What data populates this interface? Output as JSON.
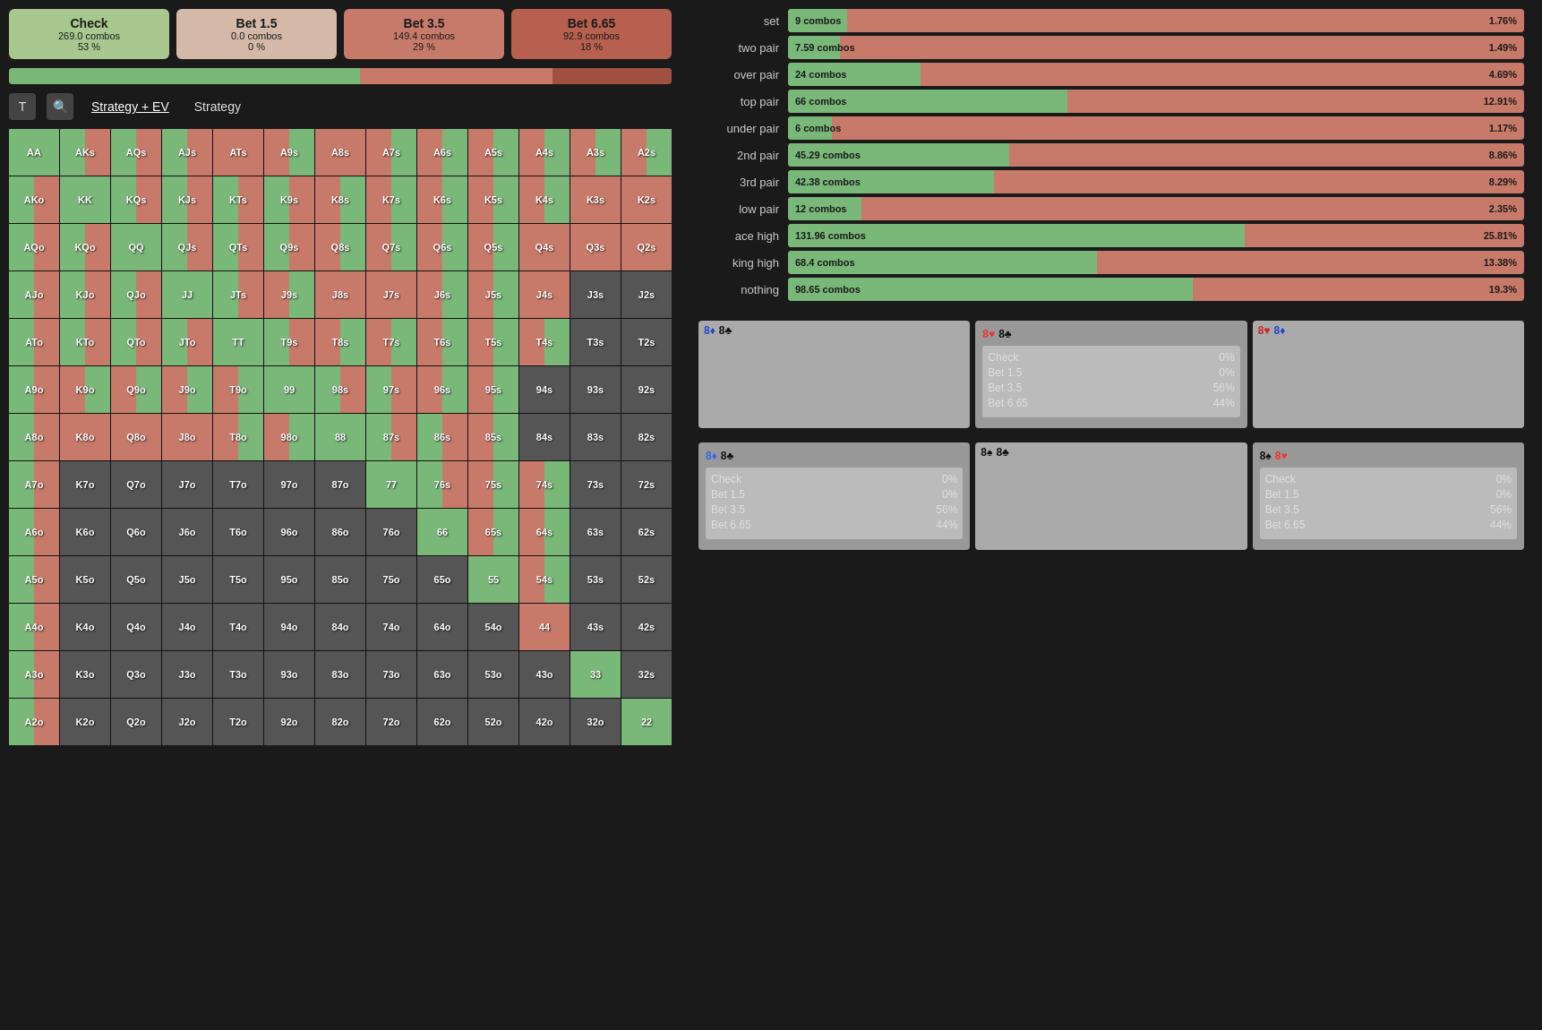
{
  "action_buttons": [
    {
      "id": "check",
      "label": "Check",
      "combos": "269.0 combos",
      "pct": "53 %",
      "active": true
    },
    {
      "id": "bet15",
      "label": "Bet 1.5",
      "combos": "0.0 combos",
      "pct": "0 %",
      "active": false
    },
    {
      "id": "bet35",
      "label": "Bet 3.5",
      "combos": "149.4 combos",
      "pct": "29 %",
      "active": false
    },
    {
      "id": "bet665",
      "label": "Bet 6.65",
      "combos": "92.9 combos",
      "pct": "18 %",
      "active": false
    }
  ],
  "progress": [
    {
      "pct": 53,
      "color": "#7ab87a"
    },
    {
      "pct": 0,
      "color": "#c8a090"
    },
    {
      "pct": 29,
      "color": "#c87a6a"
    },
    {
      "pct": 18,
      "color": "#c86a50"
    }
  ],
  "toolbar": {
    "strategy_ev_label": "Strategy + EV",
    "strategy_label": "Strategy"
  },
  "stats": [
    {
      "label": "set",
      "combos": "9 combos",
      "pct": "1.76%",
      "fill": 8
    },
    {
      "label": "two pair",
      "combos": "7.59 combos",
      "pct": "1.49%",
      "fill": 7
    },
    {
      "label": "over pair",
      "combos": "24 combos",
      "pct": "4.69%",
      "fill": 18
    },
    {
      "label": "top pair",
      "combos": "66 combos",
      "pct": "12.91%",
      "fill": 38
    },
    {
      "label": "under pair",
      "combos": "6 combos",
      "pct": "1.17%",
      "fill": 6
    },
    {
      "label": "2nd pair",
      "combos": "45.29 combos",
      "pct": "8.86%",
      "fill": 30
    },
    {
      "label": "3rd pair",
      "combos": "42.38 combos",
      "pct": "8.29%",
      "fill": 28
    },
    {
      "label": "low pair",
      "combos": "12 combos",
      "pct": "2.35%",
      "fill": 10
    },
    {
      "label": "ace high",
      "combos": "131.96 combos",
      "pct": "25.81%",
      "fill": 62
    },
    {
      "label": "king high",
      "combos": "68.4 combos",
      "pct": "13.38%",
      "fill": 42
    },
    {
      "label": "nothing",
      "combos": "98.65 combos",
      "pct": "19.3%",
      "fill": 55
    }
  ],
  "combo_panels_row1": [
    {
      "id": "panel-8d8c",
      "header": [
        {
          "rank": "8",
          "suit": "♦",
          "suit_color": "blue"
        },
        {
          "rank": "8",
          "suit": "♣",
          "suit_color": "black"
        }
      ],
      "empty": true
    },
    {
      "id": "panel-8h8c",
      "header": [
        {
          "rank": "8",
          "suit": "♥",
          "suit_color": "red"
        },
        {
          "rank": "8",
          "suit": "♣",
          "suit_color": "black"
        }
      ],
      "actions": [
        {
          "name": "Check",
          "pct": "0%"
        },
        {
          "name": "Bet 1.5",
          "pct": "0%"
        },
        {
          "name": "Bet 3.5",
          "pct": "56%"
        },
        {
          "name": "Bet 6.65",
          "pct": "44%"
        }
      ]
    },
    {
      "id": "panel-8h8d",
      "header": [
        {
          "rank": "8",
          "suit": "♥",
          "suit_color": "red"
        },
        {
          "rank": "8",
          "suit": "♦",
          "suit_color": "blue"
        }
      ],
      "empty": true
    }
  ],
  "combo_panels_row2": [
    {
      "id": "panel-8d8c-2",
      "header": [
        {
          "rank": "8",
          "suit": "♦",
          "suit_color": "blue"
        },
        {
          "rank": "8",
          "suit": "♣",
          "suit_color": "black"
        }
      ],
      "actions": [
        {
          "name": "Check",
          "pct": "0%"
        },
        {
          "name": "Bet 1.5",
          "pct": "0%"
        },
        {
          "name": "Bet 3.5",
          "pct": "56%"
        },
        {
          "name": "Bet 6.65",
          "pct": "44%"
        }
      ]
    },
    {
      "id": "panel-8s8c",
      "header": [
        {
          "rank": "8",
          "suit": "♠",
          "suit_color": "black"
        },
        {
          "rank": "8",
          "suit": "♣",
          "suit_color": "black"
        }
      ],
      "empty": true
    },
    {
      "id": "panel-8s8h",
      "header": [
        {
          "rank": "8",
          "suit": "♠",
          "suit_color": "black"
        },
        {
          "rank": "8",
          "suit": "♥",
          "suit_color": "red"
        }
      ],
      "actions": [
        {
          "name": "Check",
          "pct": "0%"
        },
        {
          "name": "Bet 1.5",
          "pct": "0%"
        },
        {
          "name": "Bet 3.5",
          "pct": "56%"
        },
        {
          "name": "Bet 6.65",
          "pct": "44%"
        }
      ]
    }
  ],
  "grid": {
    "rows": [
      [
        "AA",
        "AKs",
        "AQs",
        "AJs",
        "ATs",
        "A9s",
        "A8s",
        "A7s",
        "A6s",
        "A5s",
        "A4s",
        "A3s",
        "A2s"
      ],
      [
        "AKo",
        "KK",
        "KQs",
        "KJs",
        "KTs",
        "K9s",
        "K8s",
        "K7s",
        "K6s",
        "K5s",
        "K4s",
        "K3s",
        "K2s"
      ],
      [
        "AQo",
        "KQo",
        "QQ",
        "QJs",
        "QTs",
        "Q9s",
        "Q8s",
        "Q7s",
        "Q6s",
        "Q5s",
        "Q4s",
        "Q3s",
        "Q2s"
      ],
      [
        "AJo",
        "KJo",
        "QJo",
        "JJ",
        "JTs",
        "J9s",
        "J8s",
        "J7s",
        "J6s",
        "J5s",
        "J4s",
        "J3s",
        "J2s"
      ],
      [
        "ATo",
        "KTo",
        "QTo",
        "JTo",
        "TT",
        "T9s",
        "T8s",
        "T7s",
        "T6s",
        "T5s",
        "T4s",
        "T3s",
        "T2s"
      ],
      [
        "A9o",
        "K9o",
        "Q9o",
        "J9o",
        "T9o",
        "99",
        "98s",
        "97s",
        "96s",
        "95s",
        "94s",
        "93s",
        "92s"
      ],
      [
        "A8o",
        "K8o",
        "Q8o",
        "J8o",
        "T8o",
        "98o",
        "88",
        "87s",
        "86s",
        "85s",
        "84s",
        "83s",
        "82s"
      ],
      [
        "A7o",
        "K7o",
        "Q7o",
        "J7o",
        "T7o",
        "97o",
        "87o",
        "77",
        "76s",
        "75s",
        "74s",
        "73s",
        "72s"
      ],
      [
        "A6o",
        "K6o",
        "Q6o",
        "J6o",
        "T6o",
        "96o",
        "86o",
        "76o",
        "66",
        "65s",
        "64s",
        "63s",
        "62s"
      ],
      [
        "A5o",
        "K5o",
        "Q5o",
        "J5o",
        "T5o",
        "95o",
        "85o",
        "75o",
        "65o",
        "55",
        "54s",
        "53s",
        "52s"
      ],
      [
        "A4o",
        "K4o",
        "Q4o",
        "J4o",
        "T4o",
        "94o",
        "84o",
        "74o",
        "64o",
        "54o",
        "44",
        "43s",
        "42s"
      ],
      [
        "A3o",
        "K3o",
        "Q3o",
        "J3o",
        "T3o",
        "93o",
        "83o",
        "73o",
        "63o",
        "53o",
        "43o",
        "33",
        "32s"
      ],
      [
        "A2o",
        "K2o",
        "Q2o",
        "J2o",
        "T2o",
        "92o",
        "82o",
        "72o",
        "62o",
        "52o",
        "42o",
        "32o",
        "22"
      ]
    ],
    "cell_colors": {
      "AA": "green",
      "AKs": "mixed-gs",
      "AQs": "mixed-gs",
      "AJs": "mixed-gs",
      "ATs": "salmon",
      "A9s": "mixed-sg",
      "A8s": "salmon",
      "A7s": "mixed-sg",
      "A6s": "mixed-sg",
      "A5s": "mixed-sg",
      "A4s": "mixed-sg",
      "A3s": "mixed-sg",
      "A2s": "mixed-sg",
      "AKo": "mixed-gs",
      "KK": "green",
      "KQs": "mixed-gs",
      "KJs": "mixed-gs",
      "KTs": "mixed-gs",
      "K9s": "mixed-gs",
      "K8s": "mixed-sg",
      "K7s": "mixed-sg",
      "K6s": "mixed-sg",
      "K5s": "mixed-sg",
      "K4s": "mixed-sg",
      "K3s": "salmon",
      "K2s": "salmon",
      "AQo": "mixed-gs",
      "KQo": "mixed-gs",
      "QQ": "green",
      "QJs": "mixed-gs",
      "QTs": "mixed-gs",
      "Q9s": "mixed-gs",
      "Q8s": "mixed-sg",
      "Q7s": "mixed-sg",
      "Q6s": "mixed-sg",
      "Q5s": "mixed-sg",
      "Q4s": "salmon",
      "Q3s": "salmon",
      "Q2s": "salmon",
      "AJo": "mixed-gs",
      "KJo": "mixed-gs",
      "QJo": "mixed-gs",
      "JJ": "green",
      "JTs": "mixed-gs",
      "J9s": "mixed-sg",
      "J8s": "salmon",
      "J7s": "salmon",
      "J6s": "mixed-sg",
      "J5s": "mixed-sg",
      "J4s": "salmon",
      "J3s": "gray",
      "J2s": "gray",
      "ATo": "mixed-gs",
      "KTo": "mixed-gs",
      "QTo": "mixed-gs",
      "JTo": "mixed-gs",
      "TT": "green",
      "T9s": "mixed-gs",
      "T8s": "mixed-sg",
      "T7s": "mixed-sg",
      "T6s": "mixed-sg",
      "T5s": "mixed-sg",
      "T4s": "mixed-sg",
      "T3s": "gray",
      "T2s": "gray",
      "A9o": "mixed-gs",
      "K9o": "mixed-sg",
      "Q9o": "mixed-sg",
      "J9o": "mixed-sg",
      "T9o": "mixed-sg",
      "99": "green",
      "98s": "mixed-gs",
      "97s": "mixed-gs",
      "96s": "mixed-sg",
      "95s": "mixed-sg",
      "94s": "gray",
      "93s": "gray",
      "92s": "gray",
      "A8o": "mixed-gs",
      "K8o": "salmon",
      "Q8o": "salmon",
      "J8o": "salmon",
      "T8o": "mixed-sg",
      "98o": "mixed-sg",
      "88": "green",
      "87s": "mixed-gs",
      "86s": "mixed-gs",
      "85s": "mixed-sg",
      "84s": "gray",
      "83s": "gray",
      "82s": "gray",
      "A7o": "mixed-gs",
      "K7o": "gray",
      "Q7o": "gray",
      "J7o": "gray",
      "T7o": "gray",
      "97o": "gray",
      "87o": "gray",
      "77": "green",
      "76s": "mixed-gs",
      "75s": "mixed-sg",
      "74s": "mixed-sg",
      "73s": "gray",
      "72s": "gray",
      "A6o": "mixed-gs",
      "K6o": "gray",
      "Q6o": "gray",
      "J6o": "gray",
      "T6o": "gray",
      "96o": "gray",
      "86o": "gray",
      "76o": "gray",
      "66": "green",
      "65s": "mixed-sg",
      "64s": "mixed-sg",
      "63s": "gray",
      "62s": "gray",
      "A5o": "mixed-gs",
      "K5o": "gray",
      "Q5o": "gray",
      "J5o": "gray",
      "T5o": "gray",
      "95o": "gray",
      "85o": "gray",
      "75o": "gray",
      "65o": "gray",
      "55": "green",
      "54s": "mixed-sg",
      "53s": "gray",
      "52s": "gray",
      "A4o": "mixed-gs",
      "K4o": "gray",
      "Q4o": "gray",
      "J4o": "gray",
      "T4o": "gray",
      "94o": "gray",
      "84o": "gray",
      "74o": "gray",
      "64o": "gray",
      "54o": "gray",
      "44": "salmon",
      "43s": "gray",
      "42s": "gray",
      "A3o": "mixed-gs",
      "K3o": "gray",
      "Q3o": "gray",
      "J3o": "gray",
      "T3o": "gray",
      "93o": "gray",
      "83o": "gray",
      "73o": "gray",
      "63o": "gray",
      "53o": "gray",
      "43o": "gray",
      "33": "green",
      "32s": "gray",
      "A2o": "mixed-gs",
      "K2o": "gray",
      "Q2o": "gray",
      "J2o": "gray",
      "T2o": "gray",
      "92o": "gray",
      "82o": "gray",
      "72o": "gray",
      "62o": "gray",
      "52o": "gray",
      "42o": "gray",
      "32o": "gray",
      "22": "green"
    }
  }
}
